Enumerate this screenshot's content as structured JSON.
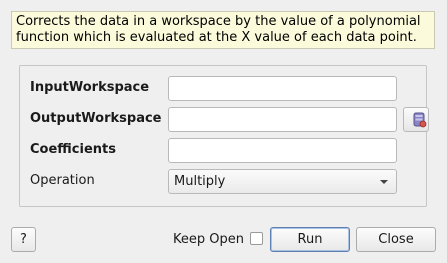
{
  "description": "Corrects the data in a workspace by the value of a polynomial function which is evaluated at the X value of each data point.",
  "properties": {
    "input_workspace": {
      "label": "InputWorkspace",
      "value": ""
    },
    "output_workspace": {
      "label": "OutputWorkspace",
      "value": ""
    },
    "coefficients": {
      "label": "Coefficients",
      "value": ""
    },
    "operation": {
      "label": "Operation",
      "value": "Multiply"
    }
  },
  "footer": {
    "help_label": "?",
    "keep_open_label": "Keep Open",
    "keep_open_checked": false,
    "run_label": "Run",
    "close_label": "Close"
  },
  "icons": {
    "workspace_button": "workspace-picker-icon"
  }
}
